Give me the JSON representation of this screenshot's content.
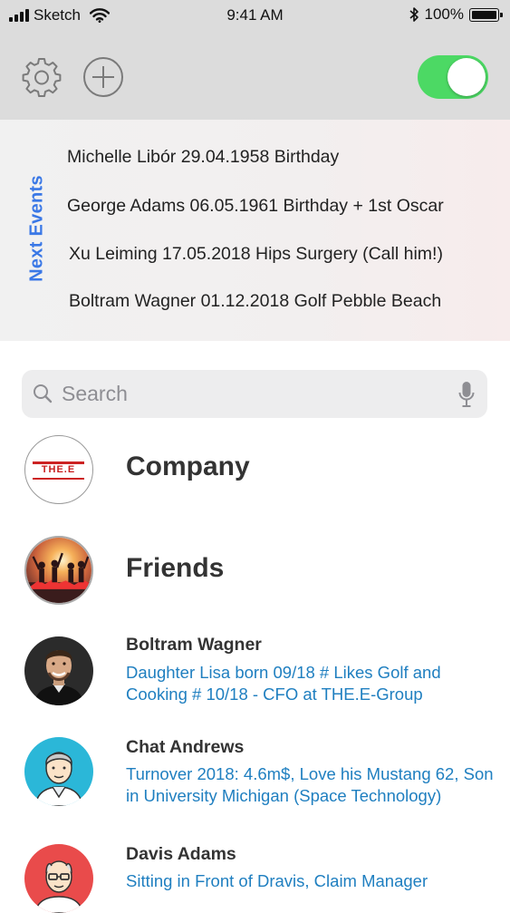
{
  "status_bar": {
    "carrier": "Sketch",
    "time": "9:41 AM",
    "battery": "100%"
  },
  "toolbar": {
    "settings_icon": "gear-icon",
    "add_icon": "plus-circle-icon",
    "toggle_on": true,
    "toggle_color": "#4cd964"
  },
  "events": {
    "label": "Next Events",
    "label_color": "#3a78e6",
    "items": [
      "Michelle Libór 29.04.1958 Birthday",
      "George Adams 06.05.1961 Birthday + 1st Oscar",
      "Xu Leiming 17.05.2018 Hips Surgery (Call him!)",
      "Boltram Wagner 01.12.2018 Golf Pebble Beach"
    ]
  },
  "search": {
    "placeholder": "Search",
    "value": ""
  },
  "groups": [
    {
      "name": "Company",
      "logo_text": "THE.E"
    },
    {
      "name": "Friends"
    }
  ],
  "contacts": [
    {
      "name": "Boltram Wagner",
      "note": "Daughter Lisa born 09/18 # Likes Golf and Cooking # 10/18 - CFO at THE.E-Group"
    },
    {
      "name": "Chat Andrews",
      "note": "Turnover 2018: 4.6m$, Love his Mustang 62, Son in University Michigan (Space Technology)"
    },
    {
      "name": "Davis Adams",
      "note": "Sitting in Front of Dravis, Claim Manager"
    }
  ],
  "colors": {
    "note_text": "#1f7fc0",
    "header_bg": "#dcdcdc"
  }
}
